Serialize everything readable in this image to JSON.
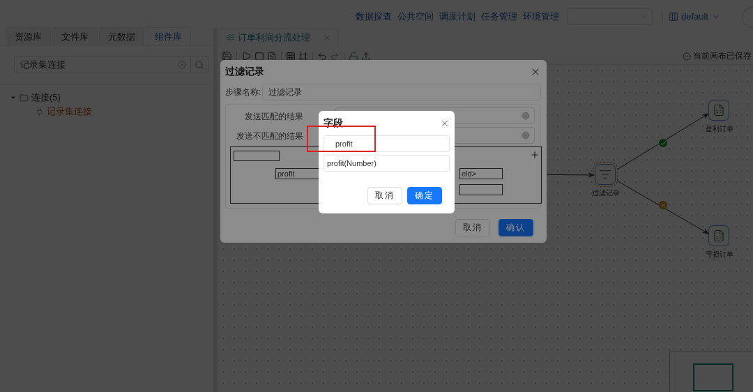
{
  "header": {
    "nav_links": [
      {
        "label": "数据探查"
      },
      {
        "label": "公共空间"
      },
      {
        "label": "调度计划"
      },
      {
        "label": "任务管理"
      },
      {
        "label": "环境管理"
      }
    ],
    "workspace": "default"
  },
  "sidebar": {
    "tabs": [
      {
        "label": "资源库",
        "selected": false
      },
      {
        "label": "文件库",
        "selected": false
      },
      {
        "label": "元数据",
        "selected": false
      },
      {
        "label": "组件库",
        "selected": true
      }
    ],
    "search": {
      "value": "记录集连接"
    },
    "tree": [
      {
        "label": "连接(5)",
        "expanded": true,
        "children": [
          {
            "label": "记录集连接",
            "highlighted": true
          }
        ]
      }
    ]
  },
  "editor": {
    "tabs": [
      {
        "label": "订单利润分流处理",
        "selected": true
      }
    ],
    "save_status": "当前画布已保存",
    "canvas": {
      "nodes": [
        {
          "label": "过滤记录",
          "kind": "filter",
          "selected": true
        },
        {
          "label": "盈利订单",
          "kind": "excel",
          "selected": false
        },
        {
          "label": "亏损订单",
          "kind": "excel",
          "selected": false
        }
      ],
      "edges": [
        {
          "kind": "ok"
        },
        {
          "kind": "fail"
        }
      ]
    }
  },
  "filter_dialog": {
    "title": "过滤记录",
    "step_name_label": "步骤名称:",
    "step_name": "过滤记录",
    "targets": [
      {
        "label": "发送匹配的结果"
      },
      {
        "label": "发送不匹配的结果"
      }
    ],
    "condition": {
      "field": "profit",
      "value": "eld>"
    },
    "buttons": [
      {
        "label": "取消",
        "kind": "default"
      },
      {
        "label": "确认",
        "kind": "primary"
      }
    ]
  },
  "field_dialog": {
    "title": "字段",
    "search": {
      "value": "profit"
    },
    "options": [
      {
        "label": "profit(Number)"
      }
    ],
    "highlighted": true,
    "buttons": [
      {
        "label": "取消",
        "kind": "default"
      },
      {
        "label": "确定",
        "kind": "primary"
      }
    ]
  }
}
